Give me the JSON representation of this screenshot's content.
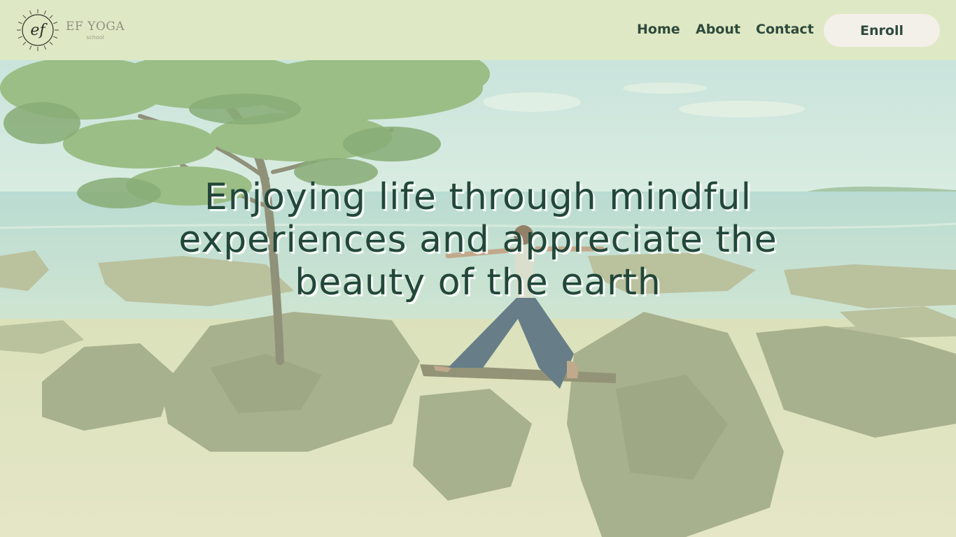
{
  "header": {
    "logo": {
      "monogram": "ef",
      "name": "EF YOGA",
      "subtitle": "school",
      "icon": "sun-monogram-icon"
    },
    "nav": {
      "home": "Home",
      "about": "About",
      "contact": "Contact"
    },
    "enroll_label": "Enroll"
  },
  "hero": {
    "headline": "Enjoying life through mindful experiences and appreciate the beauty of the earth",
    "image": "woman-doing-yoga-pose-on-bench-between-rocks-at-beach-under-tree"
  },
  "colors": {
    "header_bg": "#dfe8c4",
    "text_dark_green": "#2e4a3c",
    "headline_green": "#22473a",
    "button_bg": "#f3f0ea"
  }
}
